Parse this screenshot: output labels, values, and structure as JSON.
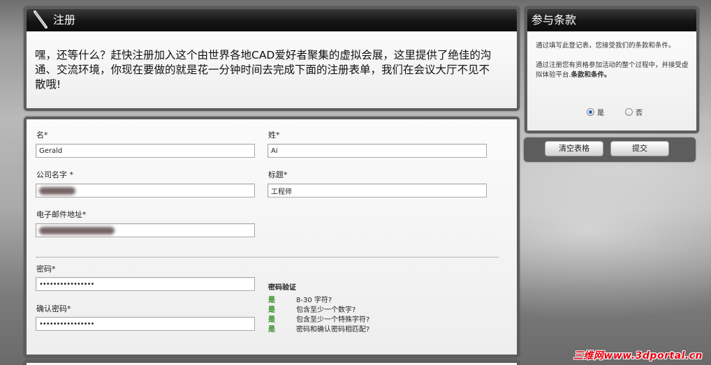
{
  "register": {
    "title": "注册",
    "intro": "嘿，还等什么？赶快注册加入这个由世界各地CAD爱好者聚集的虚拟会展，这里提供了绝佳的沟通、交流环境，你现在要做的就是花一分钟时间去完成下面的注册表单，我们在会议大厅不见不散哦!"
  },
  "form": {
    "first_name": {
      "label": "名*",
      "value": "Gerald"
    },
    "last_name": {
      "label": "姓*",
      "value": "Ai"
    },
    "company": {
      "label": "公司名字 *",
      "value": ""
    },
    "job_title": {
      "label": "标题*",
      "value": "工程师"
    },
    "email": {
      "label": "电子邮件地址*",
      "value": ""
    },
    "password": {
      "label": "密码*",
      "value": "••••••••••••••••"
    },
    "confirm_password": {
      "label": "确认密码*",
      "value": "••••••••••••••••"
    }
  },
  "password_check": {
    "title": "密码验证",
    "rows": [
      {
        "status": "是",
        "text": "8-30 字符?"
      },
      {
        "status": "是",
        "text": "包含至少一个数字?"
      },
      {
        "status": "是",
        "text": "包含至少一个特殊字符?"
      },
      {
        "status": "是",
        "text": "密码和确认密码相匹配?"
      }
    ],
    "status_color": "#2d8a1f"
  },
  "terms": {
    "title": "参与条款",
    "para1": "通过填写此登记表，您接受我们的条款和条件。",
    "para2_prefix": "通过注册您有资格参加活动的整个过程中，并接受虚拟体验平台.",
    "para2_bold": "条款和条件。",
    "yes_label": "是",
    "no_label": "否",
    "selected": "是"
  },
  "buttons": {
    "clear": "清空表格",
    "submit": "提交"
  },
  "watermark": "三维网www.3dportal.cn",
  "colors": {
    "accent_header": "#111111",
    "watermark": "#e60012"
  }
}
